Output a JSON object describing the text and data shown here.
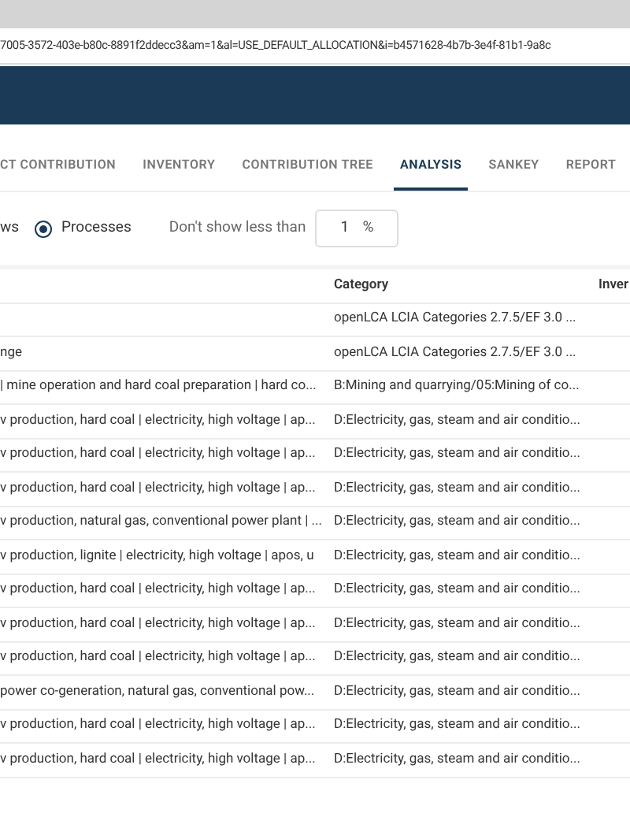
{
  "browser": {
    "url": "7005-3572-403e-b80c-8891f2ddecc3&am=1&al=USE_DEFAULT_ALLOCATION&i=b4571628-4b7b-3e4f-81b1-9a8c"
  },
  "tabs": [
    {
      "label": "CT CONTRIBUTION",
      "selected": false
    },
    {
      "label": "INVENTORY",
      "selected": false
    },
    {
      "label": "CONTRIBUTION TREE",
      "selected": false
    },
    {
      "label": "ANALYSIS",
      "selected": true
    },
    {
      "label": "SANKEY",
      "selected": false
    },
    {
      "label": "REPORT",
      "selected": false
    }
  ],
  "filter": {
    "flows_label": "ws",
    "processes_option": {
      "label": "Processes",
      "selected": true
    },
    "threshold_label": "Don't show less than",
    "threshold_value": "1",
    "threshold_unit": "%"
  },
  "table": {
    "header": {
      "category": "Category",
      "column_3": "Inver"
    },
    "rows": [
      {
        "category": "openLCA LCIA Categories 2.7.5/EF 3.0 ..."
      },
      {
        "name": "nge",
        "category": "openLCA LCIA Categories 2.7.5/EF 3.0 ..."
      },
      {
        "name": "| mine operation and hard coal preparation | hard co...",
        "category": "B:Mining and quarrying/05:Mining of co..."
      },
      {
        "name": "v production, hard coal | electricity, high voltage | ap...",
        "category": "D:Electricity, gas, steam and air conditio..."
      },
      {
        "name": "v production, hard coal | electricity, high voltage | ap...",
        "category": "D:Electricity, gas, steam and air conditio..."
      },
      {
        "name": "v production, hard coal | electricity, high voltage | ap...",
        "category": "D:Electricity, gas, steam and air conditio..."
      },
      {
        "name": "v production, natural gas, conventional power plant | ...",
        "category": "D:Electricity, gas, steam and air conditio..."
      },
      {
        "name": "v production, lignite | electricity, high voltage | apos, u",
        "category": "D:Electricity, gas, steam and air conditio..."
      },
      {
        "name": "v production, hard coal | electricity, high voltage | ap...",
        "category": "D:Electricity, gas, steam and air conditio..."
      },
      {
        "name": "v production, hard coal | electricity, high voltage | ap...",
        "category": "D:Electricity, gas, steam and air conditio..."
      },
      {
        "name": "v production, hard coal | electricity, high voltage | ap...",
        "category": "D:Electricity, gas, steam and air conditio..."
      },
      {
        "name": "power co-generation, natural gas, conventional pow...",
        "category": "D:Electricity, gas, steam and air conditio..."
      },
      {
        "name": "v production, hard coal | electricity, high voltage | ap...",
        "category": "D:Electricity, gas, steam and air conditio..."
      },
      {
        "name": "v production, hard coal | electricity, high voltage | ap...",
        "category": "D:Electricity, gas, steam and air conditio..."
      }
    ]
  }
}
